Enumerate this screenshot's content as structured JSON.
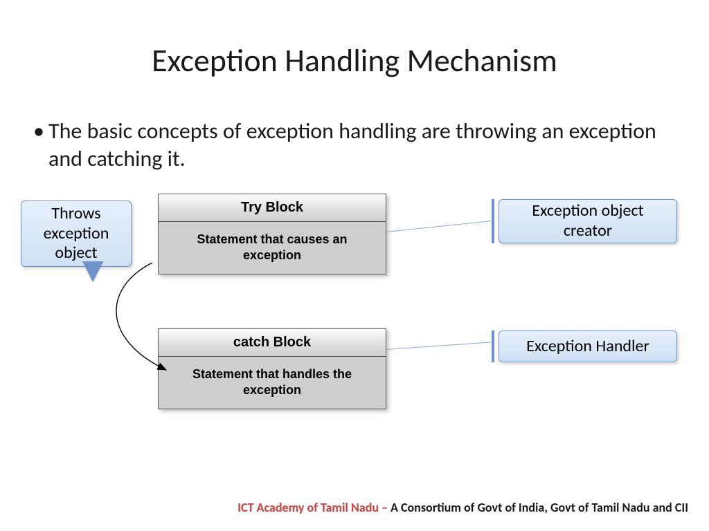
{
  "title": "Exception Handling Mechanism",
  "bullet": "The basic concepts of exception handling are throwing an exception and catching it.",
  "tryBlock": {
    "header": "Try Block",
    "body": "Statement that causes an exception"
  },
  "catchBlock": {
    "header": "catch Block",
    "body": "Statement that handles the exception"
  },
  "callout": {
    "throws": "Throws exception object",
    "creator": "Exception object creator",
    "handler": "Exception Handler"
  },
  "footer": {
    "org": "ICT Academy of Tamil Nadu – ",
    "rest": "A Consortium of Govt of India, Govt of Tamil Nadu and CII"
  },
  "colors": {
    "accentBlue": "#cfe0f4",
    "accentBorder": "#6e93c8",
    "footerOrg": "#c0504d"
  }
}
